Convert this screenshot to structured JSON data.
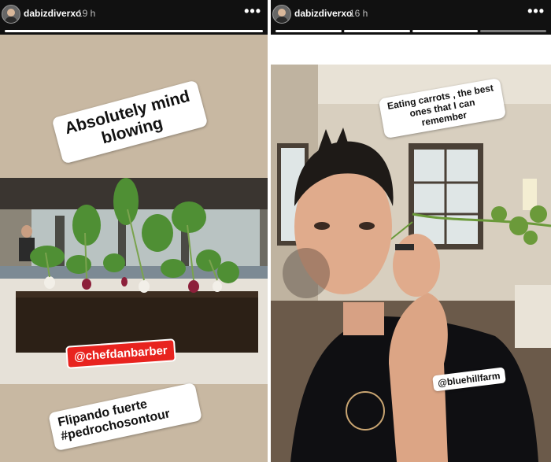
{
  "stories": [
    {
      "username": "dabizdiverxo",
      "time": "19 h",
      "headline": "Absolutely mind blowing",
      "mention": "@chefdanbarber",
      "caption_line1": "Flipando fuerte",
      "caption_line2": "#pedrochosontour"
    },
    {
      "username": "dabizdiverxo",
      "time": "16 h",
      "headline": "Eating carrots , the best ones that I can remember",
      "mention": "@bluehillfarm"
    }
  ],
  "menu_icon": "more-icon",
  "colors": {
    "mention_red": "#e8231f",
    "caption_sticker": "#ffffff",
    "topbar": "#111111"
  }
}
